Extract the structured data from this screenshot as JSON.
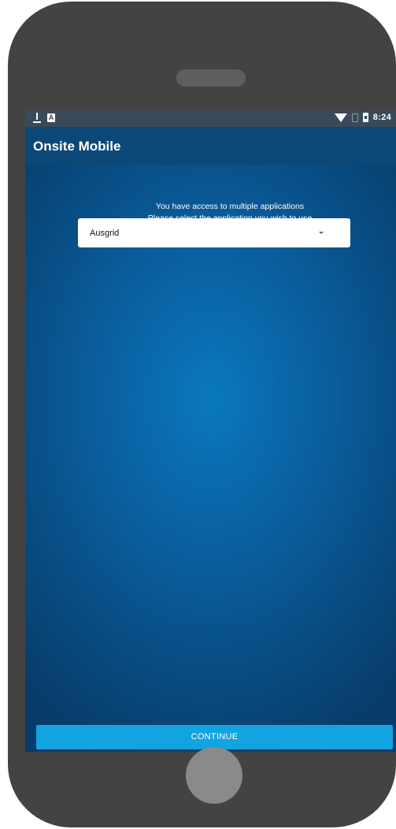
{
  "status_bar": {
    "time": "8:24",
    "icons": [
      "download-icon",
      "a-notification-icon",
      "wifi-icon",
      "no-sim-icon",
      "battery-icon"
    ],
    "a_icon_glyph": "A"
  },
  "app_bar": {
    "title": "Onsite Mobile"
  },
  "message": {
    "line1": "You have access to multiple applications",
    "line2": "Please select the application you wish to use"
  },
  "app_select": {
    "selected": "Ausgrid"
  },
  "actions": {
    "continue_label": "CONTINUE"
  },
  "colors": {
    "app_bar": "#0c4877",
    "button": "#12a4e0",
    "background_center": "#0a78bd",
    "background_edge": "#073c6a",
    "device_frame": "#434343"
  }
}
